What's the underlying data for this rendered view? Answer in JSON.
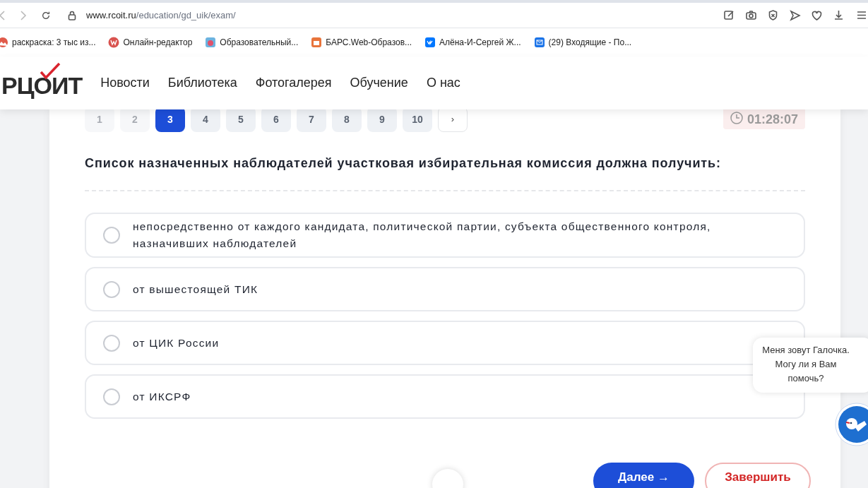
{
  "browser": {
    "url_host": "www.rcoit.ru",
    "url_path": "/education/gd_uik/exam/",
    "bookmarks": [
      {
        "label": "раскраска: 3 тыс из...",
        "kind": "photo"
      },
      {
        "label": "Онлайн-редактор",
        "kind": "w"
      },
      {
        "label": "Образовательный...",
        "kind": "app"
      },
      {
        "label": "БАРС.Web-Образов...",
        "kind": "bars"
      },
      {
        "label": "Алёна-И-Сергей Ж...",
        "kind": "vk"
      },
      {
        "label": "(29) Входящие - По...",
        "kind": "mail"
      }
    ]
  },
  "site": {
    "logo": "РЦОИТ",
    "nav": [
      "Новости",
      "Библиотека",
      "Фотогалерея",
      "Обучение",
      "О нас"
    ]
  },
  "pager": {
    "pages": [
      {
        "label": "1",
        "selected": false,
        "faded": true
      },
      {
        "label": "2",
        "selected": false,
        "faded": true
      },
      {
        "label": "3",
        "selected": true,
        "faded": false
      },
      {
        "label": "4",
        "selected": false,
        "faded": false
      },
      {
        "label": "5",
        "selected": false,
        "faded": false
      },
      {
        "label": "6",
        "selected": false,
        "faded": false
      },
      {
        "label": "7",
        "selected": false,
        "faded": false
      },
      {
        "label": "8",
        "selected": false,
        "faded": false
      },
      {
        "label": "9",
        "selected": false,
        "faded": false
      },
      {
        "label": "10",
        "selected": false,
        "faded": false
      }
    ],
    "next": "›"
  },
  "timer": "01:28:07",
  "question": "Список назначенных наблюдателей участковая избирательная комиссия должна получить:",
  "answers": [
    {
      "text": "непосредственно от каждого кандидата, политической партии, субъекта общественного контроля, назначивших наблюдателей",
      "selected": false
    },
    {
      "text": "от вышестоящей ТИК",
      "selected": false
    },
    {
      "text": "от ЦИК России",
      "selected": false
    },
    {
      "text": "от ИКСРФ",
      "selected": false
    }
  ],
  "buttons": {
    "next": "Далее →",
    "finish": "Завершить"
  },
  "chat": {
    "message": "Меня зовут Галочка. Могу ли я Вам помочь?"
  }
}
